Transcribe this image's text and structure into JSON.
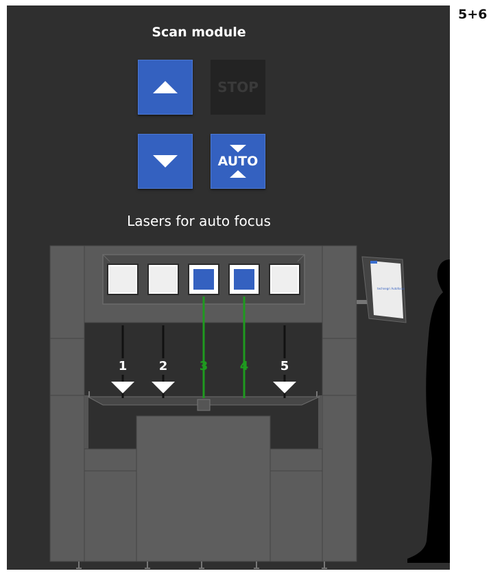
{
  "page_number": "5+6",
  "title": "Scan module",
  "controls": {
    "up_button": {
      "icon": "arrow-up-icon"
    },
    "stop_button": {
      "label": "STOP",
      "state": "disabled"
    },
    "down_button": {
      "icon": "arrow-down-icon"
    },
    "auto_button": {
      "label": "AUTO"
    }
  },
  "lasers": {
    "heading": "Lasers for auto focus",
    "items": [
      {
        "label": "1",
        "active": false
      },
      {
        "label": "2",
        "active": false
      },
      {
        "label": "3",
        "active": true
      },
      {
        "label": "4",
        "active": true
      },
      {
        "label": "5",
        "active": false
      }
    ]
  },
  "monitor": {
    "screen_text": "technegri Autofocus"
  },
  "colors": {
    "panel_bg": "#2f2f2f",
    "button_blue": "#3461c0",
    "laser_active": "#1f9a1f",
    "laser_inactive": "#111111",
    "machine_gray": "#5c5c5c"
  }
}
